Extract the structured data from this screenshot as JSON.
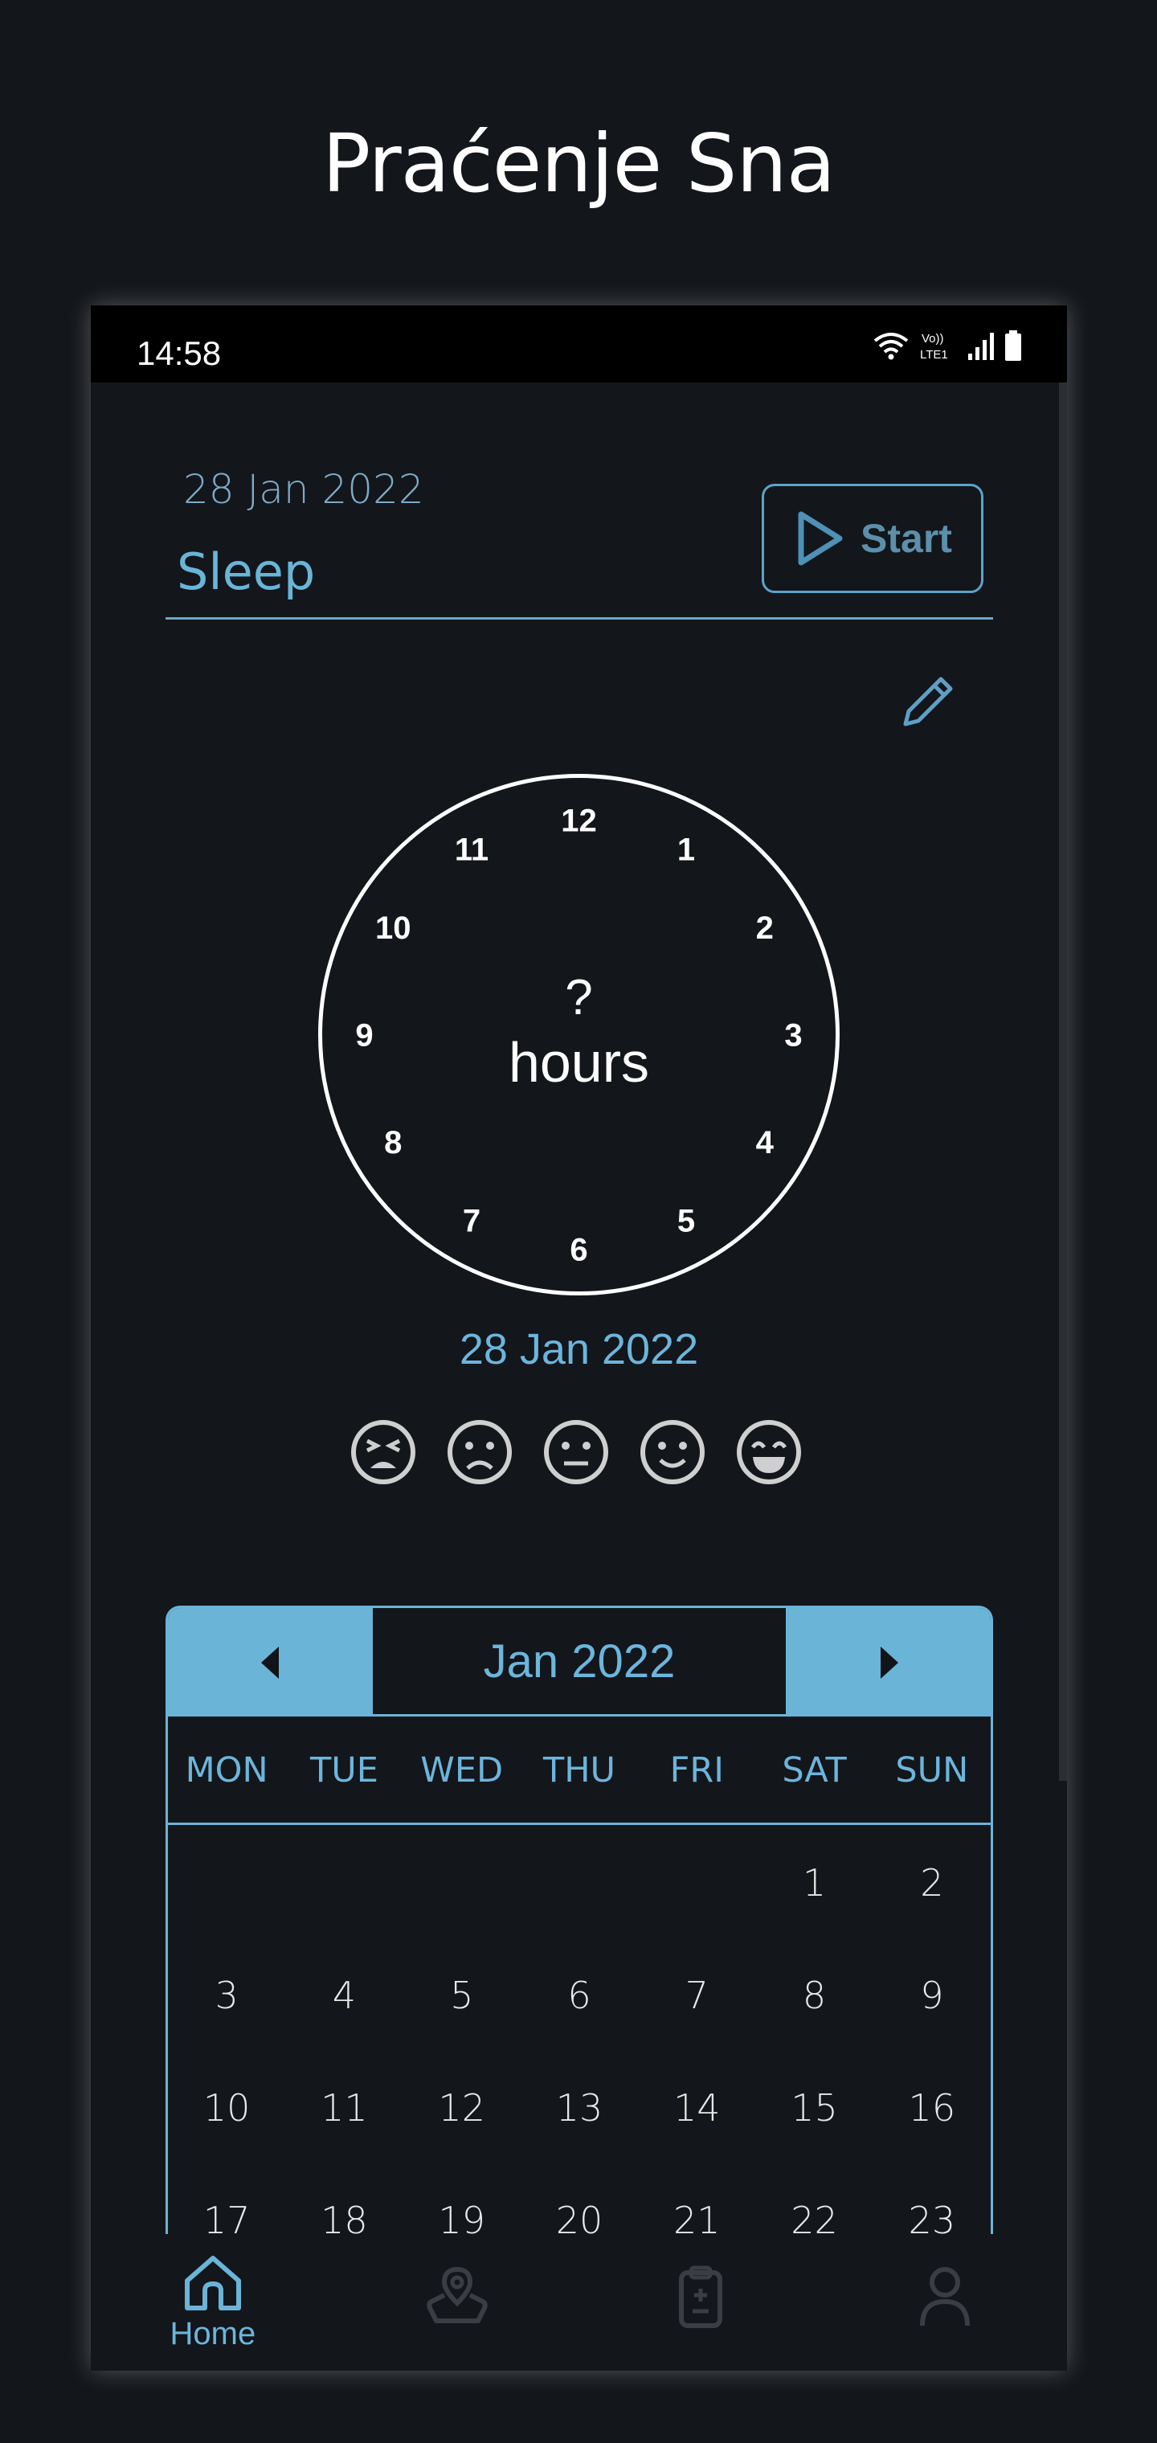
{
  "header": {
    "title": "Praćenje Sna"
  },
  "status_bar": {
    "time": "14:58",
    "network_label_top": "Vo))",
    "network_label_bottom": "LTE1"
  },
  "entry": {
    "date": "28 Jan 2022",
    "label": "Sleep",
    "start_label": "Start"
  },
  "clock": {
    "numbers": [
      "12",
      "1",
      "2",
      "3",
      "4",
      "5",
      "6",
      "7",
      "8",
      "9",
      "10",
      "11"
    ],
    "value": "?",
    "unit": "hours"
  },
  "selected_date": "28 Jan 2022",
  "moods": [
    "very-sad-icon",
    "sad-icon",
    "neutral-icon",
    "happy-icon",
    "very-happy-icon"
  ],
  "calendar": {
    "month": "Jan 2022",
    "weekdays": [
      "MON",
      "TUE",
      "WED",
      "THU",
      "FRI",
      "SAT",
      "SUN"
    ],
    "weeks": [
      [
        "",
        "",
        "",
        "",
        "",
        "1",
        "2"
      ],
      [
        "3",
        "4",
        "5",
        "6",
        "7",
        "8",
        "9"
      ],
      [
        "10",
        "11",
        "12",
        "13",
        "14",
        "15",
        "16"
      ],
      [
        "17",
        "18",
        "19",
        "20",
        "21",
        "22",
        "23"
      ]
    ]
  },
  "nav": {
    "items": [
      {
        "icon": "home-icon",
        "label": "Home",
        "active": true
      },
      {
        "icon": "map-pin-icon",
        "label": "",
        "active": false
      },
      {
        "icon": "clipboard-icon",
        "label": "",
        "active": false
      },
      {
        "icon": "person-icon",
        "label": "",
        "active": false
      }
    ]
  },
  "colors": {
    "accent": "#6ab4d8",
    "background": "#13161b",
    "inactive": "#3a3e44"
  }
}
